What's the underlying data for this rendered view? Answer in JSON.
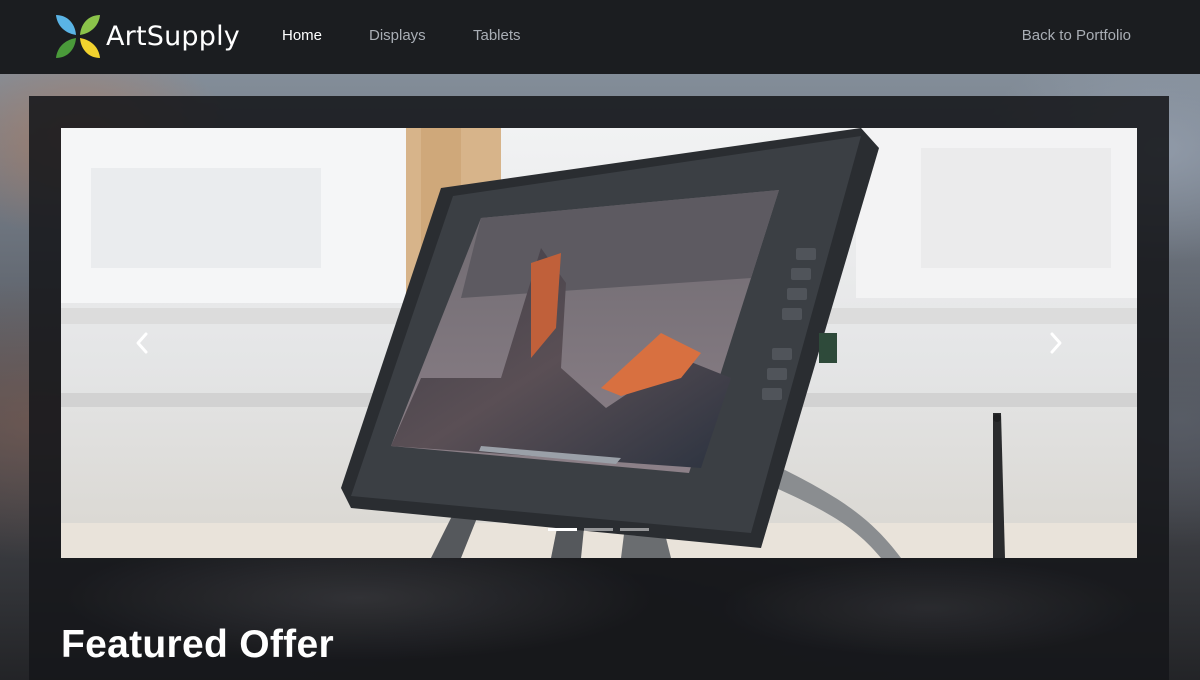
{
  "brand": {
    "name": "ArtSupply"
  },
  "nav": {
    "items": [
      {
        "label": "Home",
        "active": true
      },
      {
        "label": "Displays",
        "active": false
      },
      {
        "label": "Tablets",
        "active": false
      }
    ],
    "back_label": "Back to Portfolio"
  },
  "carousel": {
    "slide_count": 3,
    "active_index": 0,
    "prev_icon": "chevron-left-icon",
    "next_icon": "chevron-right-icon"
  },
  "featured": {
    "title": "Featured Offer"
  },
  "colors": {
    "header_bg": "#1b1d20",
    "panel_bg": "#16171a",
    "nav_active": "#ffffff",
    "nav_inactive": "#a9aeb5",
    "logo_leaf_blue": "#5ab4e6",
    "logo_leaf_green": "#8bc34a",
    "logo_leaf_yellow": "#f2d22e",
    "logo_leaf_darkgreen": "#4a9a3a"
  }
}
